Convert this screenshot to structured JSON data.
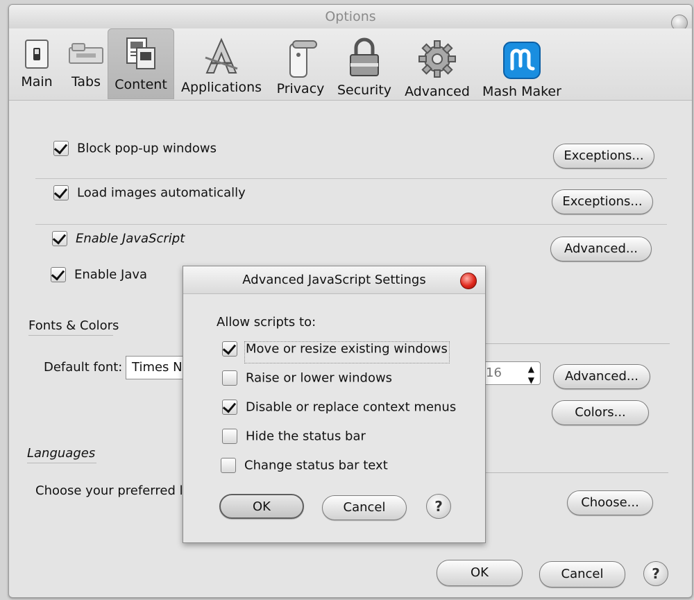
{
  "window": {
    "title": "Options"
  },
  "toolbar": {
    "tabs": [
      {
        "label": "Main",
        "icon": "switch-icon"
      },
      {
        "label": "Tabs",
        "icon": "tabs-icon"
      },
      {
        "label": "Content",
        "icon": "content-icon",
        "selected": true
      },
      {
        "label": "Applications",
        "icon": "applications-icon"
      },
      {
        "label": "Privacy",
        "icon": "privacy-icon"
      },
      {
        "label": "Security",
        "icon": "lock-icon"
      },
      {
        "label": "Advanced",
        "icon": "gear-icon"
      },
      {
        "label": "Mash Maker",
        "icon": "mash-maker-icon"
      }
    ]
  },
  "content": {
    "block_popups": {
      "label": "Block pop-up windows",
      "checked": true,
      "button": "Exceptions..."
    },
    "load_images": {
      "label": "Load images automatically",
      "checked": true,
      "button": "Exceptions..."
    },
    "enable_js": {
      "label": "Enable JavaScript",
      "checked": true,
      "button": "Advanced..."
    },
    "enable_java": {
      "label": "Enable Java",
      "checked": true
    },
    "fonts": {
      "title": "Fonts & Colors",
      "default_font_label": "Default font:",
      "default_font_value": "Times New Roman",
      "size_value": "16",
      "advanced_button": "Advanced...",
      "colors_button": "Colors..."
    },
    "languages": {
      "title": "Languages",
      "text": "Choose your preferred language for displaying pages",
      "button": "Choose..."
    }
  },
  "footer": {
    "ok": "OK",
    "cancel": "Cancel",
    "help": "?"
  },
  "dialog": {
    "title": "Advanced JavaScript Settings",
    "intro": "Allow scripts to:",
    "options": [
      {
        "label": "Move or resize existing windows",
        "checked": true
      },
      {
        "label": "Raise or lower windows",
        "checked": false
      },
      {
        "label": "Disable or replace context menus",
        "checked": true
      },
      {
        "label": "Hide the status bar",
        "checked": false
      },
      {
        "label": "Change status bar text",
        "checked": false
      }
    ],
    "ok": "OK",
    "cancel": "Cancel",
    "help": "?"
  },
  "colors": {
    "mash_maker_blue": "#1a8ee0",
    "close_red": "#e0281c"
  }
}
